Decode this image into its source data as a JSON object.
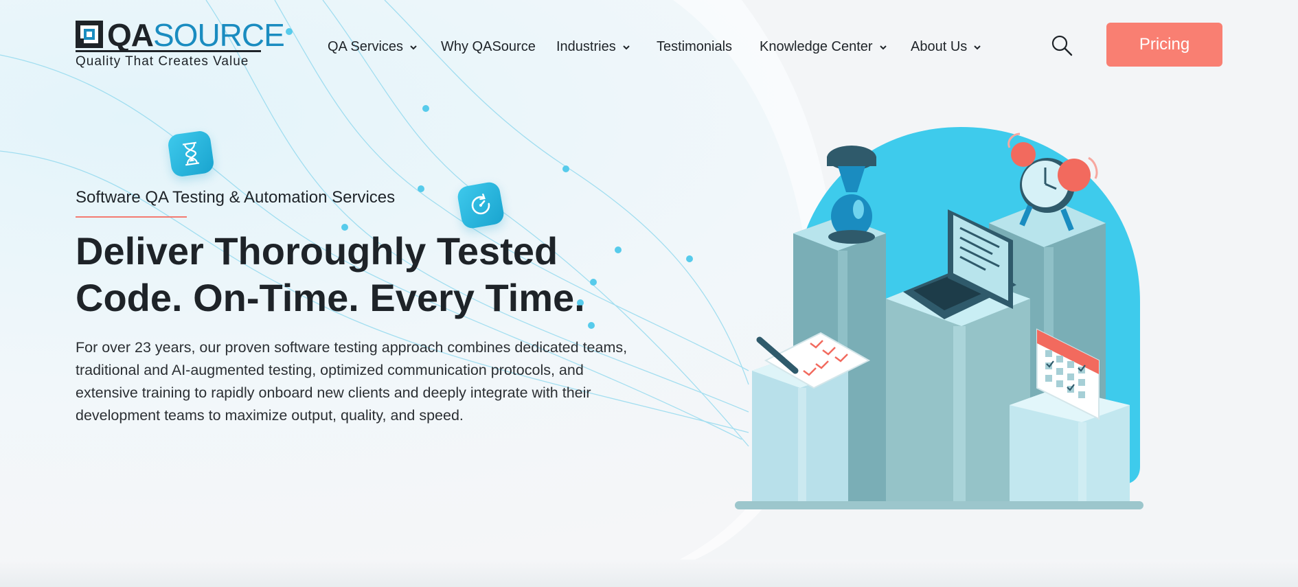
{
  "logo": {
    "word_qa": "QA",
    "word_source": "SOURCE",
    "tagline": "Quality That Creates Value"
  },
  "nav": {
    "items": [
      {
        "label": "QA Services",
        "has_dropdown": true
      },
      {
        "label": "Why QASource",
        "has_dropdown": false
      },
      {
        "label": "Industries",
        "has_dropdown": true
      },
      {
        "label": "Testimonials",
        "has_dropdown": false
      },
      {
        "label": "Knowledge Center",
        "has_dropdown": true
      },
      {
        "label": "About Us",
        "has_dropdown": true
      }
    ],
    "search_icon": "search-icon",
    "cta_label": "Pricing"
  },
  "hero": {
    "eyebrow": "Software QA Testing & Automation Services",
    "headline_line1": "Deliver Thoroughly Tested",
    "headline_line2": "Code. On-Time. Every Time.",
    "description": "For over 23 years, our proven software testing approach combines dedicated teams, traditional and AI-augmented testing, optimized communication protocols, and extensive training to rapidly onboard new clients and deeply integrate with their development teams to maximize output, quality, and speed."
  },
  "colors": {
    "accent": "#f97f72",
    "brand_blue": "#1a8cc0",
    "cyan": "#3ecbec",
    "text": "#1e2328"
  },
  "icons": {
    "badge_1": "hourglass-icon",
    "badge_2": "timer-icon"
  }
}
